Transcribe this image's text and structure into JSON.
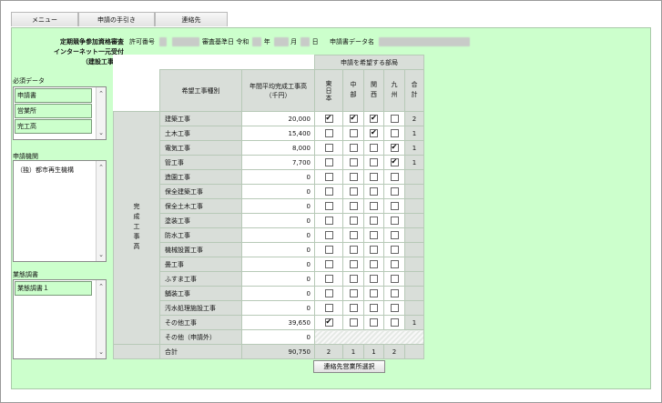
{
  "tabs": [
    "メニュー",
    "申請の手引き",
    "連絡先"
  ],
  "header": {
    "title_lines": [
      "定期競争参加資格審査",
      "インターネット一元受付",
      "（建設工事）"
    ],
    "permit_label": "許可番号",
    "base_date_label": "審査基準日 令和",
    "year_suffix": "年",
    "month_suffix": "月",
    "day_suffix": "日",
    "application_data_label": "申請書データ名"
  },
  "sidebar": {
    "required_label": "必須データ",
    "required_items": [
      "申請書",
      "営業所",
      "完工高"
    ],
    "agency_label": "申請機関",
    "agency_items": [
      "（独）都市再生機構"
    ],
    "survey_label": "業態調書",
    "survey_items": [
      "業態調書１"
    ]
  },
  "table": {
    "group_label": "申請を希望する部局",
    "head_type": "希望工事種別",
    "head_amount": "年間平均完成工事高（千円）",
    "regions": [
      "東日本",
      "中部",
      "関西",
      "九州"
    ],
    "head_total": "合計",
    "side_label": "完成工事高",
    "rows": [
      {
        "name": "建築工事",
        "amount": "20,000",
        "checks": [
          true,
          true,
          true,
          false
        ],
        "total": "2"
      },
      {
        "name": "土木工事",
        "amount": "15,400",
        "checks": [
          false,
          false,
          true,
          false
        ],
        "total": "1"
      },
      {
        "name": "電気工事",
        "amount": "8,000",
        "checks": [
          false,
          false,
          false,
          true
        ],
        "total": "1"
      },
      {
        "name": "管工事",
        "amount": "7,700",
        "checks": [
          false,
          false,
          false,
          true
        ],
        "total": "1"
      },
      {
        "name": "造園工事",
        "amount": "0",
        "checks": [
          false,
          false,
          false,
          false
        ],
        "total": ""
      },
      {
        "name": "保全建築工事",
        "amount": "0",
        "checks": [
          false,
          false,
          false,
          false
        ],
        "total": ""
      },
      {
        "name": "保全土木工事",
        "amount": "0",
        "checks": [
          false,
          false,
          false,
          false
        ],
        "total": ""
      },
      {
        "name": "塗装工事",
        "amount": "0",
        "checks": [
          false,
          false,
          false,
          false
        ],
        "total": ""
      },
      {
        "name": "防水工事",
        "amount": "0",
        "checks": [
          false,
          false,
          false,
          false
        ],
        "total": ""
      },
      {
        "name": "機械設置工事",
        "amount": "0",
        "checks": [
          false,
          false,
          false,
          false
        ],
        "total": ""
      },
      {
        "name": "畳工事",
        "amount": "0",
        "checks": [
          false,
          false,
          false,
          false
        ],
        "total": ""
      },
      {
        "name": "ふすま工事",
        "amount": "0",
        "checks": [
          false,
          false,
          false,
          false
        ],
        "total": ""
      },
      {
        "name": "舗装工事",
        "amount": "0",
        "checks": [
          false,
          false,
          false,
          false
        ],
        "total": ""
      },
      {
        "name": "汚水処理施設工事",
        "amount": "0",
        "checks": [
          false,
          false,
          false,
          false
        ],
        "total": ""
      },
      {
        "name": "その他工事",
        "amount": "39,650",
        "checks": [
          true,
          false,
          false,
          false
        ],
        "total": "1"
      }
    ],
    "other_row": {
      "name": "その他（申請外）",
      "amount": "0"
    },
    "sum_row": {
      "name": "合計",
      "amount": "90,750",
      "counts": [
        "2",
        "1",
        "1",
        "2"
      ]
    }
  },
  "button_select": "連絡先営業所選択",
  "colors": {
    "panel": "#ccffcc",
    "selected_item": "#ccffcc"
  }
}
